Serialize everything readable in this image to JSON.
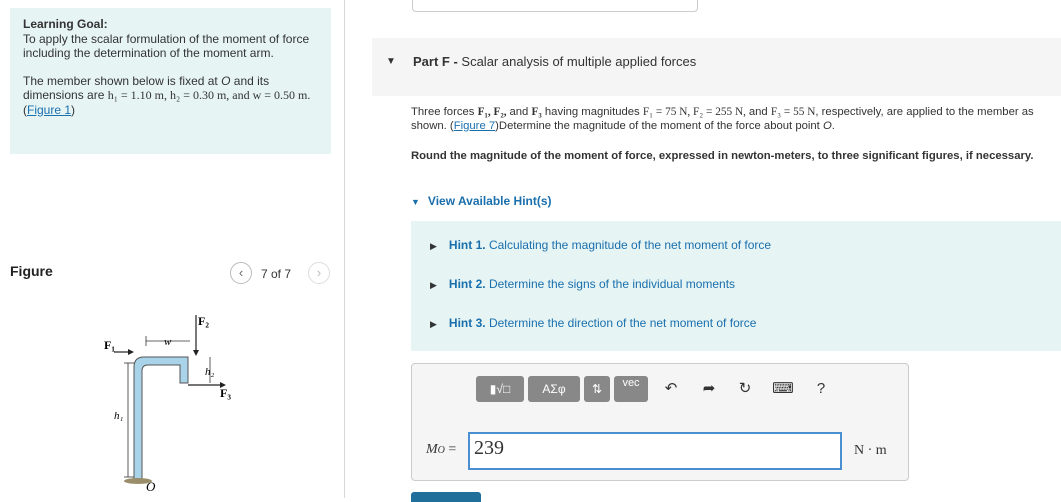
{
  "left": {
    "goal_title": "Learning Goal:",
    "goal_text": "To apply the scalar formulation of the moment of force including the determination of the moment arm.",
    "member_text_pre": "The member shown below is fixed at ",
    "member_O": "O",
    "member_text_mid": " and its dimensions are ",
    "dims": "h₁ = 1.10 m, h₂ = 0.30 m, and w = 0.50 m.",
    "figure_link": "Figure 1",
    "figure_title": "Figure",
    "figure_count": "7 of 7",
    "prev_icon": "‹",
    "next_icon": "›",
    "fig_labels": {
      "F1": "F₁",
      "F2": "F₂",
      "F3": "F₃",
      "w": "w",
      "h1": "h₁",
      "h2": "h₂",
      "O": "O"
    }
  },
  "part": {
    "letter": "Part F - ",
    "title": "Scalar analysis of multiple applied forces",
    "arrow": "▼"
  },
  "problem": {
    "text_1": "Three forces ",
    "forces": "F₁, F₂, ",
    "text_2": "and ",
    "F3": "F₃",
    "text_3": " having magnitudes ",
    "mags": "F₁ = 75 N, F₂ = 255 N, ",
    "text_4": "and ",
    "mag3": "F₃ = 55 N",
    "text_5": ", respectively, are applied to the member as shown. (",
    "fig_link": "Figure 7",
    "text_6": ")Determine the magnitude of the moment of the force about point ",
    "point": "O",
    "text_7": "."
  },
  "round_text": "Round the magnitude of the moment of force, expressed in newton-meters, to three significant figures, if necessary.",
  "hints_toggle": "View Available Hint(s)",
  "hints": [
    {
      "num": "Hint 1.",
      "text": "Calculating the magnitude of the net moment of force"
    },
    {
      "num": "Hint 2.",
      "text": "Determine the signs of the individual moments"
    },
    {
      "num": "Hint 3.",
      "text": "Determine the direction of the net moment of force"
    }
  ],
  "toolbar": {
    "templates_label": "▮√□",
    "greek_label": "ΑΣφ",
    "arrows_label": "⇅",
    "vec_label": "vec",
    "undo_icon": "↶",
    "redo_icon": "➦",
    "reset_icon": "↻",
    "keyboard_icon": "⌨",
    "help_icon": "?"
  },
  "answer": {
    "label": "M",
    "label_sub": "O",
    "equals": " =",
    "value": "239",
    "unit": "N · m"
  }
}
